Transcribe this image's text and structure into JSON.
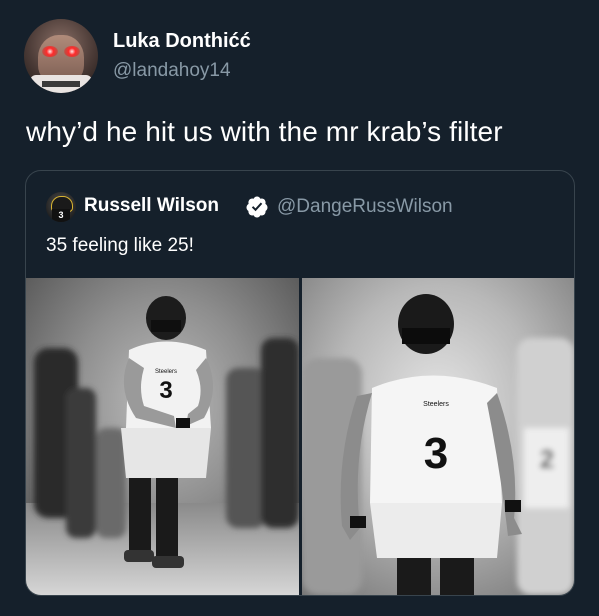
{
  "tweet": {
    "display_name": "Luka Donthićć",
    "handle": "@landahoy14",
    "text": "why’d he hit us with the mr krab’s filter"
  },
  "quoted_tweet": {
    "display_name": "Russell Wilson",
    "handle": "@DangeRussWilson",
    "text": "35 feeling like 25!",
    "verified_icon": "verified-badge-icon",
    "photos": [
      {
        "jersey_number": "3",
        "team_text": "Steelers"
      },
      {
        "jersey_number": "3",
        "team_text": "Steelers"
      }
    ]
  },
  "colors": {
    "background": "#15202b",
    "secondary_text": "#8899a6",
    "border": "#38444d"
  }
}
